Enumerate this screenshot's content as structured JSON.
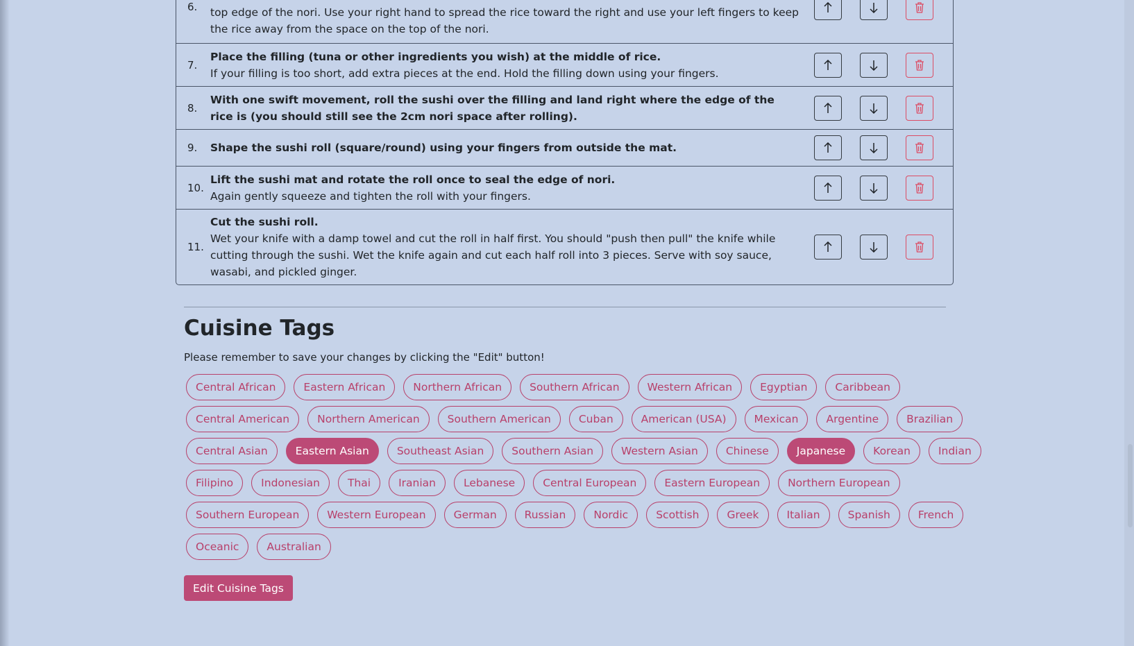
{
  "steps": [
    {
      "num": "6.",
      "title": "",
      "desc": "top edge of the nori. Use your right hand to spread the rice toward the right and use your left fingers to keep the rice away from the space on the top of the nori."
    },
    {
      "num": "7.",
      "title": "Place the filling (tuna or other ingredients you wish) at the middle of rice.",
      "desc": "If your filling is too short, add extra pieces at the end. Hold the filling down using your fingers."
    },
    {
      "num": "8.",
      "title": "With one swift movement, roll the sushi over the filling and land right where the edge of the rice is (you should still see the 2cm nori space after rolling).",
      "desc": ""
    },
    {
      "num": "9.",
      "title": "Shape the sushi roll (square/round) using your fingers from outside the mat.",
      "desc": ""
    },
    {
      "num": "10.",
      "title": "Lift the sushi mat and rotate the roll once to seal the edge of nori.",
      "desc": "Again gently squeeze and tighten the roll with your fingers."
    },
    {
      "num": "11.",
      "title": "Cut the sushi roll.",
      "desc": "Wet your knife with a damp towel and cut the roll in half first. You should \"push then pull\" the knife while cutting through the sushi. Wet the knife again and cut each half roll into 3 pieces. Serve with soy sauce, wasabi, and pickled ginger."
    }
  ],
  "step_buttons": {
    "up_icon": "arrow-up-icon",
    "down_icon": "arrow-down-icon",
    "delete_icon": "trash-icon"
  },
  "cuisine": {
    "title": "Cuisine Tags",
    "note": "Please remember to save your changes by clicking the \"Edit\" button!",
    "rows": [
      [
        {
          "label": "Central African",
          "selected": false
        },
        {
          "label": "Eastern African",
          "selected": false
        },
        {
          "label": "Northern African",
          "selected": false
        },
        {
          "label": "Southern African",
          "selected": false
        },
        {
          "label": "Western African",
          "selected": false
        },
        {
          "label": "Egyptian",
          "selected": false
        },
        {
          "label": "Caribbean",
          "selected": false
        }
      ],
      [
        {
          "label": "Central American",
          "selected": false
        },
        {
          "label": "Northern American",
          "selected": false
        },
        {
          "label": "Southern American",
          "selected": false
        },
        {
          "label": "Cuban",
          "selected": false
        },
        {
          "label": "American (USA)",
          "selected": false
        },
        {
          "label": "Mexican",
          "selected": false
        },
        {
          "label": "Argentine",
          "selected": false
        },
        {
          "label": "Brazilian",
          "selected": false
        }
      ],
      [
        {
          "label": "Central Asian",
          "selected": false
        },
        {
          "label": "Eastern Asian",
          "selected": true
        },
        {
          "label": "Southeast Asian",
          "selected": false
        },
        {
          "label": "Southern Asian",
          "selected": false
        },
        {
          "label": "Western Asian",
          "selected": false
        },
        {
          "label": "Chinese",
          "selected": false
        },
        {
          "label": "Japanese",
          "selected": true
        },
        {
          "label": "Korean",
          "selected": false
        },
        {
          "label": "Indian",
          "selected": false
        }
      ],
      [
        {
          "label": "Filipino",
          "selected": false
        },
        {
          "label": "Indonesian",
          "selected": false
        },
        {
          "label": "Thai",
          "selected": false
        },
        {
          "label": "Iranian",
          "selected": false
        },
        {
          "label": "Lebanese",
          "selected": false
        },
        {
          "label": "Central European",
          "selected": false
        },
        {
          "label": "Eastern European",
          "selected": false
        },
        {
          "label": "Northern European",
          "selected": false
        }
      ],
      [
        {
          "label": "Southern European",
          "selected": false
        },
        {
          "label": "Western European",
          "selected": false
        },
        {
          "label": "German",
          "selected": false
        },
        {
          "label": "Russian",
          "selected": false
        },
        {
          "label": "Nordic",
          "selected": false
        },
        {
          "label": "Scottish",
          "selected": false
        },
        {
          "label": "Greek",
          "selected": false
        },
        {
          "label": "Italian",
          "selected": false
        },
        {
          "label": "Spanish",
          "selected": false
        },
        {
          "label": "French",
          "selected": false
        }
      ],
      [
        {
          "label": "Oceanic",
          "selected": false
        },
        {
          "label": "Australian",
          "selected": false
        }
      ]
    ],
    "edit_button": "Edit Cuisine Tags"
  },
  "colors": {
    "background": "#c6d3e9",
    "accent": "#bc4a76",
    "danger": "#dc4c64"
  }
}
